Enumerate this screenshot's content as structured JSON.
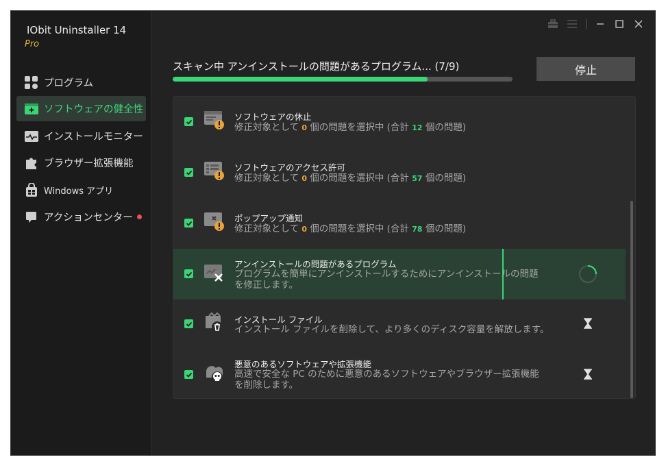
{
  "app": {
    "name": "IObit Uninstaller 14",
    "edition": "Pro"
  },
  "sidebar": {
    "items": [
      {
        "label": "プログラム",
        "icon": "programs-grid-icon",
        "active": false
      },
      {
        "label": "ソフトウェアの健全性",
        "icon": "software-health-icon",
        "active": true
      },
      {
        "label": "インストールモニター",
        "icon": "install-monitor-icon",
        "active": false
      },
      {
        "label": "ブラウザー拡張機能",
        "icon": "puzzle-icon",
        "active": false
      },
      {
        "label": "Windows アプリ",
        "icon": "windows-apps-icon",
        "active": false
      },
      {
        "label": "アクションセンター",
        "icon": "action-center-icon",
        "active": false,
        "badge_color": "#ee4f55"
      }
    ]
  },
  "titlebar": {
    "icons": [
      "toolbox-icon",
      "menu-icon",
      "minimize-icon",
      "maximize-icon",
      "close-icon"
    ]
  },
  "scan": {
    "title": "スキャン中 アンインストールの問題があるプログラム... (7/9)",
    "progress": 0.75,
    "stop_label": "停止"
  },
  "items": [
    {
      "title": "ソフトウェアの休止",
      "desc_prefix": "修正対象として",
      "selected": "0",
      "desc_mid": "個の問題を選択中 (合計",
      "total": "12",
      "desc_suffix": "個の問題)",
      "checked": true,
      "status": "none"
    },
    {
      "title": "ソフトウェアのアクセス許可",
      "desc_prefix": "修正対象として",
      "selected": "0",
      "desc_mid": "個の問題を選択中 (合計",
      "total": "57",
      "desc_suffix": "個の問題)",
      "checked": true,
      "status": "none"
    },
    {
      "title": "ポップアップ通知",
      "desc_prefix": "修正対象として",
      "selected": "0",
      "desc_mid": "個の問題を選択中 (合計",
      "total": "78",
      "desc_suffix": "個の問題)",
      "checked": true,
      "status": "none"
    },
    {
      "title": "アンインストールの問題があるプログラム",
      "desc": "プログラムを簡単にアンインストールするためにアンインストールの問題を修正します。",
      "checked": true,
      "status": "scanning"
    },
    {
      "title": "インストール ファイル",
      "desc": "インストール ファイルを削除して、より多くのディスク容量を解放します。",
      "checked": true,
      "status": "waiting"
    },
    {
      "title": "悪意のあるソフトウェアや拡張機能",
      "desc": "高速で安全な PC のために悪意のあるソフトウェアやブラウザー拡張機能を削除します。",
      "checked": true,
      "status": "waiting"
    }
  ],
  "colors": {
    "accent": "#3ad676",
    "warning": "#e8a33a",
    "badge": "#ee4f55"
  }
}
